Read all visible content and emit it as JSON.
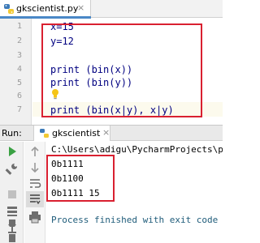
{
  "editor_tab": {
    "title": "gkscientist.py",
    "close": "×",
    "icon": "python-file-icon"
  },
  "editor": {
    "line_numbers": [
      "1",
      "2",
      "3",
      "4",
      "5",
      "6",
      "7"
    ],
    "lines": [
      "x=15",
      "y=12",
      "",
      "print (bin(x))",
      "print (bin(y))",
      "",
      "print (bin(x|y), x|y)"
    ],
    "current_line": "7",
    "intention_icon": "lightbulb-icon",
    "highlight_color": "#d92030"
  },
  "run_panel": {
    "label": "Run:",
    "tab_title": "gkscientist",
    "tab_close": "×",
    "tab_icon": "python-run-icon"
  },
  "console": {
    "path": "C:\\Users\\adigu\\PycharmProjects\\pyt",
    "output": [
      "0b1111",
      "0b1100",
      "0b1111 15"
    ],
    "exit_message": "Process finished with exit code 0"
  },
  "toolbar_left": [
    "rerun-icon",
    "settings-wrench-icon",
    "stop-icon",
    "layout-icon",
    "pin-icon",
    "trash-icon"
  ],
  "toolbar_mid": [
    "up-arrow-icon",
    "down-arrow-icon",
    "soft-wrap-icon",
    "scroll-to-end-icon",
    "print-icon"
  ]
}
